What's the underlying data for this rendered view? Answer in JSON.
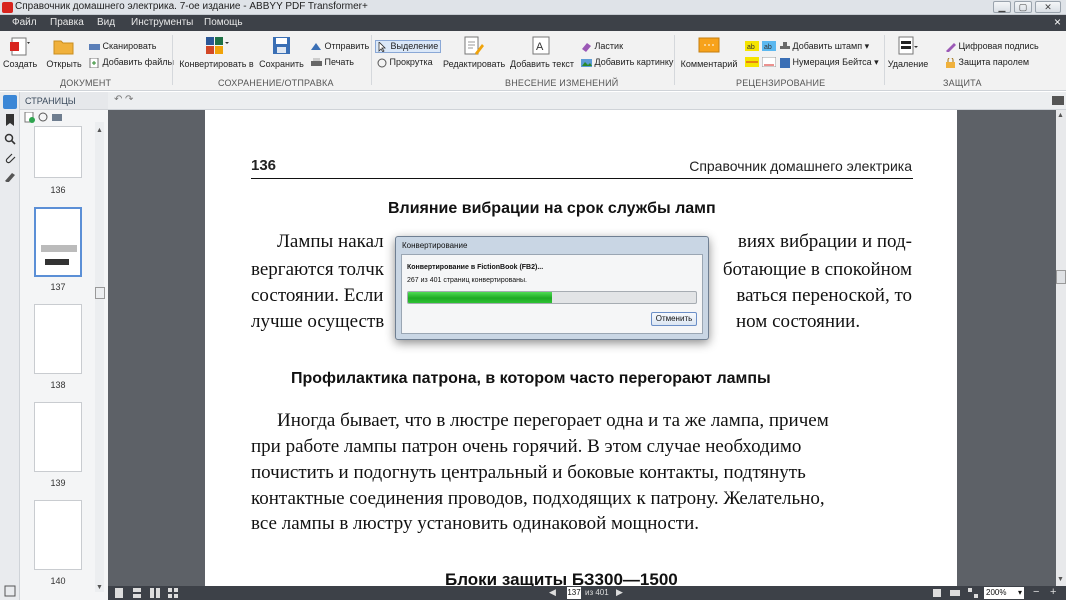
{
  "window": {
    "title": "Справочник домашнего электрика. 7-ое издание - ABBYY PDF Transformer+",
    "controls": {
      "minimize": "▁",
      "maximize": "▢",
      "close": "✕"
    }
  },
  "menu": {
    "items": [
      "Файл",
      "Правка",
      "Вид",
      "Инструменты",
      "Помощь"
    ],
    "close": "×"
  },
  "ribbon": {
    "create": "Создать",
    "open": "Открыть",
    "scan": "Сканировать",
    "add_files": "Добавить файлы",
    "convert_to": "Конвертировать в",
    "save": "Сохранить",
    "send": "Отправить",
    "print": "Печать",
    "select": "Выделение",
    "hand": "Прокрутка",
    "edit": "Редактировать",
    "add_text": "Добавить текст",
    "eraser": "Ластик",
    "add_picture": "Добавить картинку",
    "comment": "Комментарий",
    "add_stamp": "Добавить штамп",
    "bates": "Нумерация Бейтса",
    "delete": "Удаление",
    "digital_signature": "Цифровая подпись",
    "password": "Защита паролем",
    "groups": {
      "document": "ДОКУМЕНТ",
      "save_send": "СОХРАНЕНИЕ/ОТПРАВКА",
      "changes": "ВНЕСЕНИЕ ИЗМЕНЕНИЙ",
      "review": "РЕЦЕНЗИРОВАНИЕ",
      "protect": "ЗАЩИТА"
    }
  },
  "pages_panel": {
    "title": "СТРАНИЦЫ",
    "thumbs": [
      "136",
      "137",
      "138",
      "139",
      "140"
    ],
    "selected": "137"
  },
  "document": {
    "page_number": "136",
    "running_head": "Справочник домашнего электрика",
    "heading1": "Влияние вибрации на срок службы ламп",
    "p1": [
      "Лампы накал",
      "виях вибрации и под-",
      "вергаются толчк",
      "ботающие в спокойном",
      "состоянии. Если",
      "ваться переноской, то",
      "лучше осуществ",
      "ном состоянии."
    ],
    "heading2": "Профилактика патрона, в котором часто перегорают лампы",
    "p2": [
      "Иногда бывает, что в люстре перегорает одна и та же лампа, причем",
      "при работе лампы патрон очень горячий. В этом случае необходимо",
      "почистить и подогнуть центральный и боковые контакты, подтянуть",
      "контактные соединения проводов, подходящих к патрону. Желательно,",
      "все лампы в люстру установить одинаковой мощности."
    ],
    "heading3": "Блоки защиты БЗ300—1500"
  },
  "dialog": {
    "title": "Конвертирование",
    "line1": "Конвертирование в FictionBook (FB2)...",
    "line2": "267 из 401 страниц конвертированы.",
    "progress": 0.5,
    "cancel": "Отменить"
  },
  "status": {
    "current_page": "137",
    "of_pages": "из 401",
    "zoom": "200%"
  },
  "colors": {
    "menubar": "#3d4148",
    "progress": "#2ec234",
    "selection": "#5b8fd6"
  }
}
